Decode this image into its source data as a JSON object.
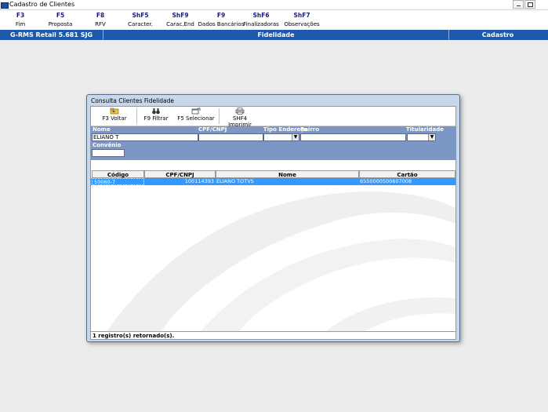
{
  "window": {
    "title": "Cadastro de Clientes"
  },
  "fkeys": [
    {
      "key": "F3",
      "label": "Fim"
    },
    {
      "key": "F5",
      "label": "Proposta"
    },
    {
      "key": "F8",
      "label": "RFV"
    },
    {
      "key": "ShF5",
      "label": "Caracter."
    },
    {
      "key": "ShF9",
      "label": "Carac.End"
    },
    {
      "key": "F9",
      "label": "Dados Bancários"
    },
    {
      "key": "ShF6",
      "label": "Finalizadoras"
    },
    {
      "key": "ShF7",
      "label": "Observações"
    }
  ],
  "statusbar": {
    "left": "G-RMS Retail 5.681 SJG",
    "center": "Fidelidade",
    "right": "Cadastro"
  },
  "dialog": {
    "title": "Consulta Clientes Fidelidade",
    "toolbar": {
      "voltar": "F3 Voltar",
      "filtrar": "F9 Filtrar",
      "selecionar": "F5 Selecionar",
      "imprimir": "SHF4 Imprimir"
    },
    "filters": {
      "nome_label": "Nome",
      "nome_value": "ELIANO T",
      "cpf_label": "CPF/CNPJ",
      "cpf_value": "",
      "tipo_endereco_label": "Tipo Endereço",
      "bairro_label": "Bairro",
      "bairro_value": "",
      "titularidade_label": "Titularidade",
      "convenio_label": "Convênio",
      "convenio_value": ""
    },
    "grid": {
      "columns": [
        "Código",
        "CPF/CNPJ",
        "Nome",
        "Cartão"
      ],
      "rows": [
        {
          "codigo": "50060-7",
          "cpf": "100114393",
          "nome": "ELIANO TOTVS",
          "cartao": "6550000500607008"
        }
      ]
    },
    "status": "1 registro(s) retornado(s)."
  },
  "colors": {
    "accent": "#1f59ab",
    "selection": "#3399ff",
    "filter_panel": "#7c96c6"
  }
}
